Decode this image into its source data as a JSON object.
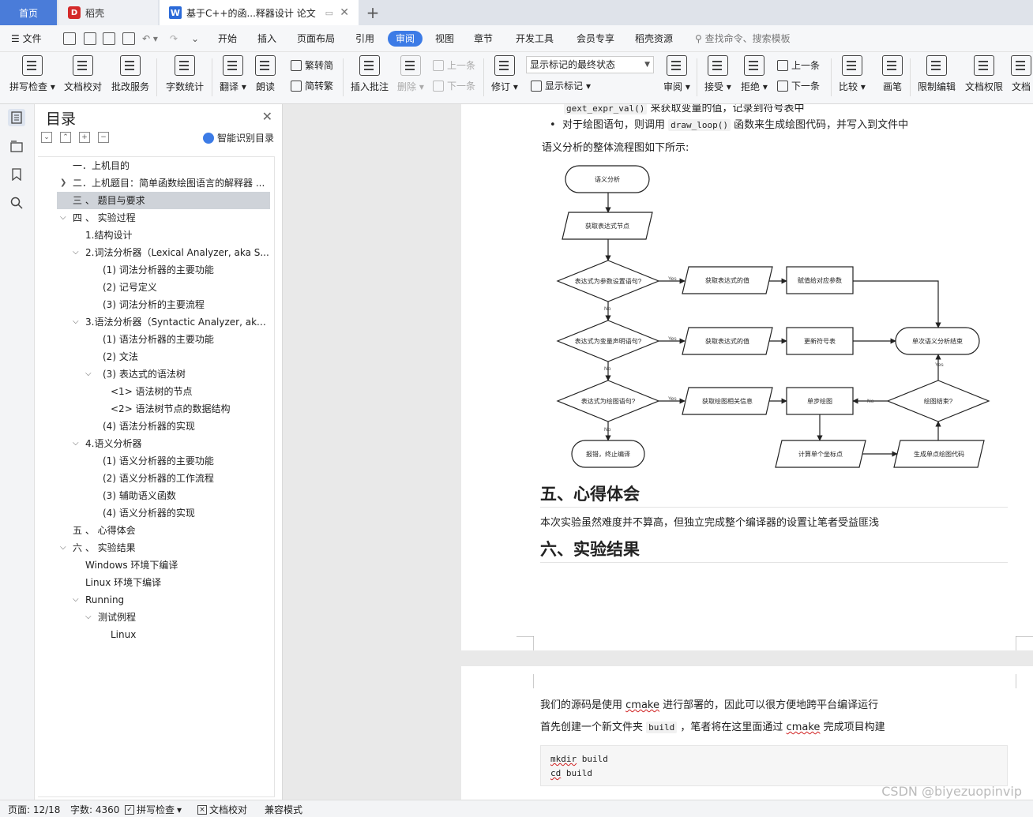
{
  "tabs": {
    "home": "首页",
    "daoke": "稻壳",
    "doc": "基于C++的函...释器设计 论文",
    "add": "+"
  },
  "menu": {
    "file": "文件",
    "items": [
      "开始",
      "插入",
      "页面布局",
      "引用",
      "审阅",
      "视图",
      "章节",
      "开发工具",
      "会员专享",
      "稻壳资源"
    ],
    "active": "审阅",
    "search": "查找命令、搜索模板"
  },
  "ribbon": {
    "spell": "拼写检查",
    "doccheck": "文档校对",
    "review_service": "批改服务",
    "wordcount": "字数统计",
    "translate": "翻译",
    "read": "朗读",
    "trad": "繁转简",
    "simp": "简转繁",
    "insert_comment": "插入批注",
    "delete": "删除",
    "prev": "上一条",
    "next": "下一条",
    "track": "修订",
    "markup_select": "显示标记的最终状态",
    "show_markup": "显示标记",
    "review": "审阅",
    "accept": "接受",
    "reject": "拒绝",
    "prev2": "上一条",
    "next2": "下一条",
    "compare": "比较",
    "pen": "画笔",
    "restrict": "限制编辑",
    "perm": "文档权限",
    "doc_cut": "文档"
  },
  "toc": {
    "title": "目录",
    "smart": "智能识别目录",
    "items": [
      {
        "label": "一．上机目的"
      },
      {
        "label": "二．上机题目：简单函数绘图语言的解释器 ..."
      },
      {
        "label": "三 、 题目与要求"
      },
      {
        "label": "四 、 实验过程"
      },
      {
        "label": "1.结构设计"
      },
      {
        "label": "2.词法分析器（Lexical Analyzer, aka S..."
      },
      {
        "label": "(1) 词法分析器的主要功能"
      },
      {
        "label": "(2) 记号定义"
      },
      {
        "label": "(3) 词法分析的主要流程"
      },
      {
        "label": "3.语法分析器（Syntactic Analyzer, aka ..."
      },
      {
        "label": "(1) 语法分析器的主要功能"
      },
      {
        "label": "(2) 文法"
      },
      {
        "label": "(3) 表达式的语法树"
      },
      {
        "label": "<1> 语法树的节点"
      },
      {
        "label": "<2> 语法树节点的数据结构"
      },
      {
        "label": "(4) 语法分析器的实现"
      },
      {
        "label": "4.语义分析器"
      },
      {
        "label": "(1) 语义分析器的主要功能"
      },
      {
        "label": "(2) 语义分析器的工作流程"
      },
      {
        "label": "(3) 辅助语义函数"
      },
      {
        "label": "(4) 语义分析器的实现"
      },
      {
        "label": "五 、 心得体会"
      },
      {
        "label": "六 、 实验结果"
      },
      {
        "label": "Windows 环境下编译"
      },
      {
        "label": "Linux 环境下编译"
      },
      {
        "label": "Running"
      },
      {
        "label": "测试例程"
      },
      {
        "label": "Linux"
      }
    ]
  },
  "doc": {
    "cut_line_code": "gext_expr_val()",
    "cut_line_text": "来获取变量的值，记录到符号表中",
    "bullet_a": "对于绘图语句，则调用",
    "bullet_code": "draw_loop()",
    "bullet_b": "函数来生成绘图代码，并写入到文件中",
    "flow_intro": "语义分析的整体流程图如下所示:",
    "h5": "五、心得体会",
    "p5": "本次实验虽然难度并不算高，但独立完成整个编译器的设置让笔者受益匪浅",
    "h6": "六、实验结果",
    "p6a_1": "我们的源码是使用",
    "p6a_code": "cmake",
    "p6a_2": "进行部署的，因此可以很方便地跨平台编译运行",
    "p6b_1": "首先创建一个新文件夹",
    "p6b_code": "build",
    "p6b_2": "，笔者将在这里面通过",
    "p6b_code2": "cmake",
    "p6b_3": "完成项目构建",
    "code_line1_cmd": "mkdir",
    "code_line1_arg": "build",
    "code_line2_cmd": "cd",
    "code_line2_arg": "build"
  },
  "flow": {
    "n_start": "语义分析",
    "n_get_node": "获取表达式节点",
    "d_param": "表达式为参数设置语句?",
    "n_get_val1": "获取表达式的值",
    "n_assign": "赋值给对应参数",
    "d_var": "表达式为变量声明语句?",
    "n_get_val2": "获取表达式的值",
    "n_update": "更新符号表",
    "n_end_single": "单次语义分析结束",
    "d_draw": "表达式为绘图语句?",
    "n_get_draw": "获取绘图相关信息",
    "n_step": "单步绘图",
    "d_done": "绘图结束?",
    "n_error": "报错，终止编译",
    "n_calc": "计算单个坐标点",
    "n_gen": "生成单点绘图代码",
    "yes": "Yes",
    "no": "No"
  },
  "status": {
    "page": "页面: 12/18",
    "words": "字数: 4360",
    "spell": "拼写检查",
    "doccheck": "文档校对",
    "compat": "兼容模式"
  },
  "watermark": "CSDN @biyezuopinvip"
}
